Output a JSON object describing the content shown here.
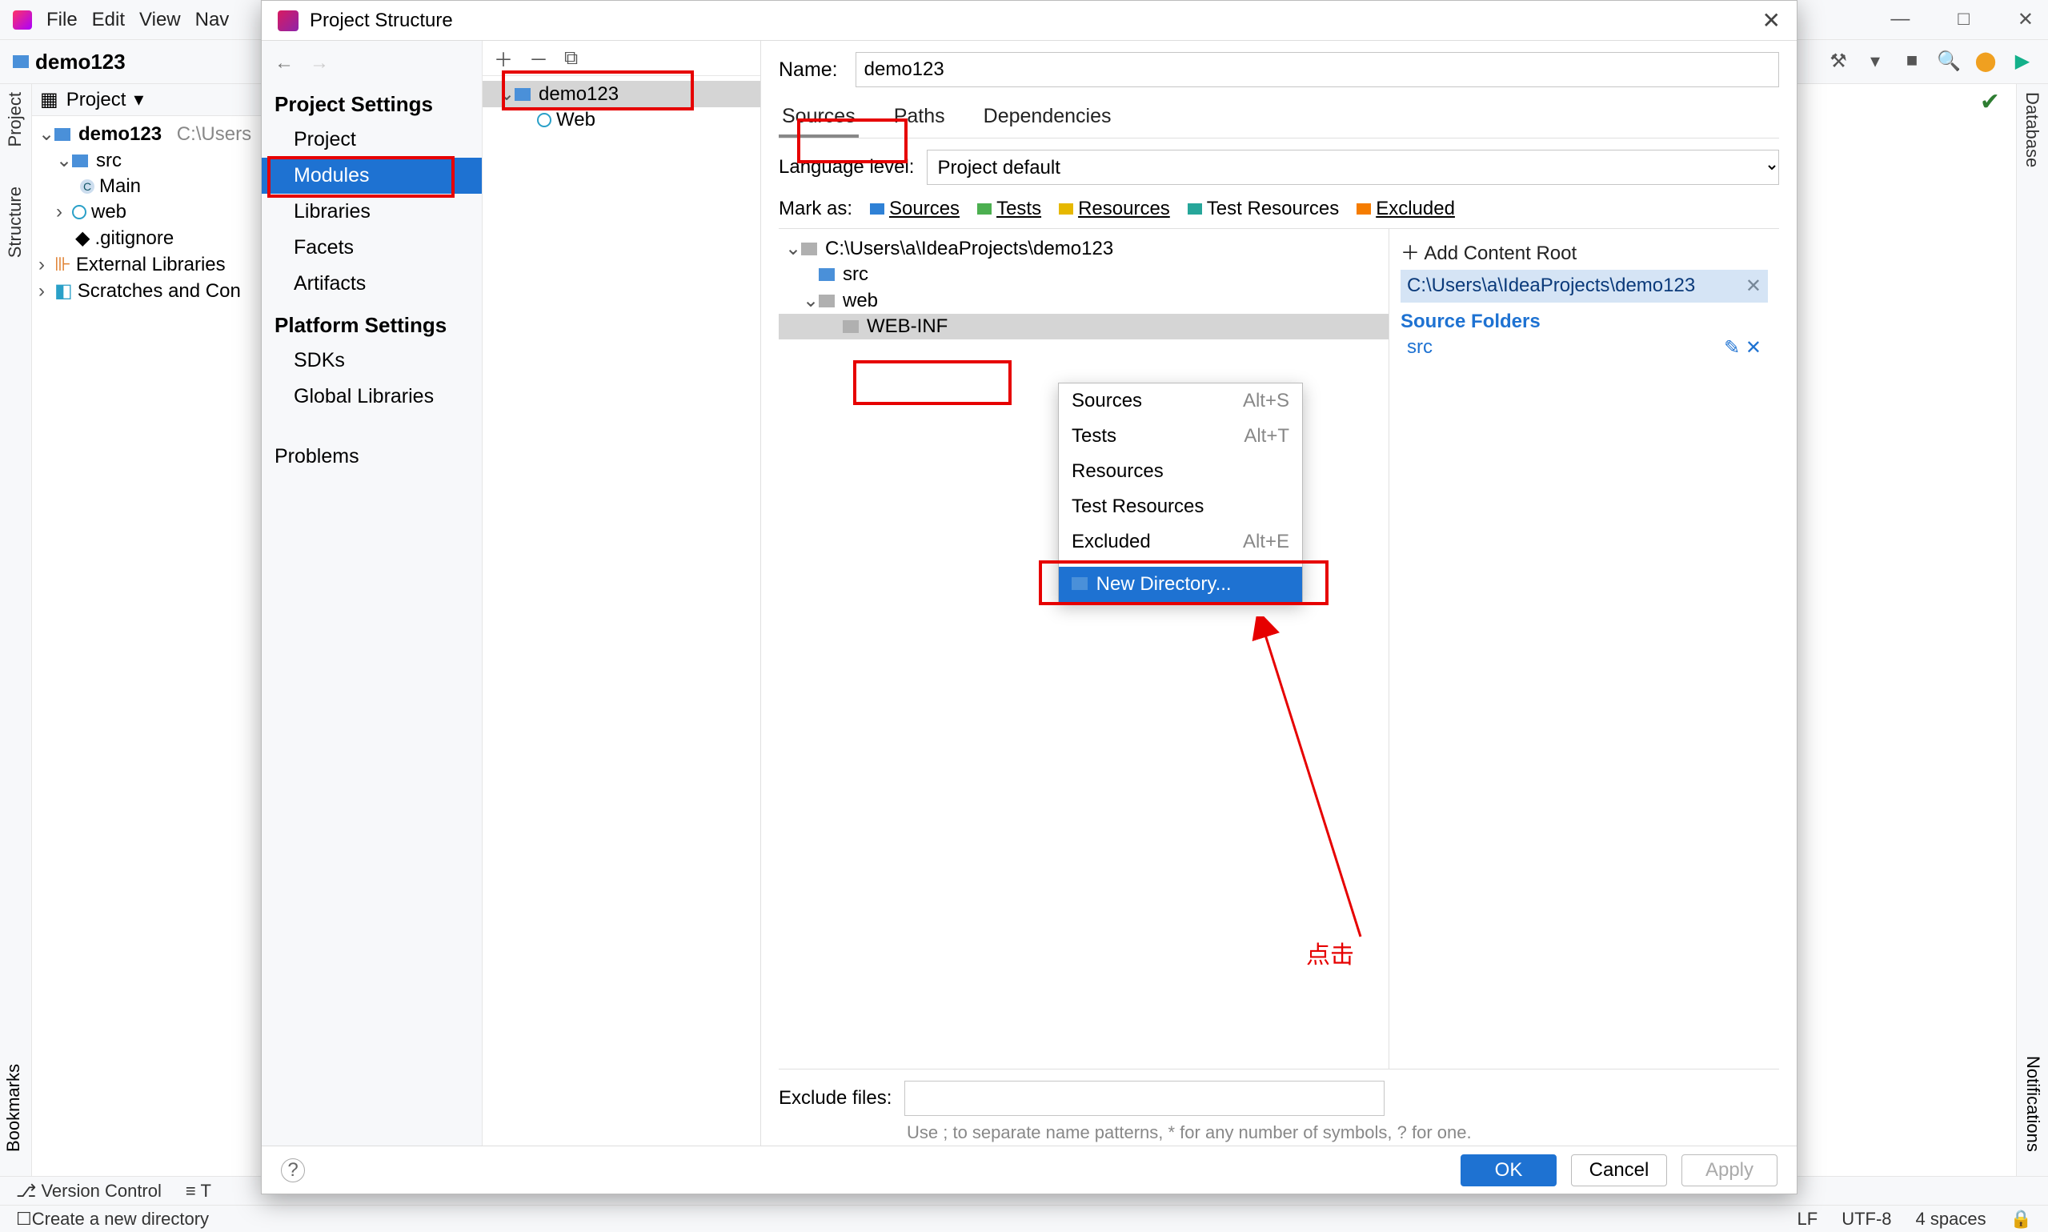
{
  "mainMenu": {
    "items": [
      "File",
      "Edit",
      "View",
      "Nav"
    ]
  },
  "breadcrumb": {
    "project": "demo123"
  },
  "projectPanel": {
    "title": "Project",
    "root": "demo123",
    "rootPath": "C:\\Users",
    "nodes": {
      "src": "src",
      "main": "Main",
      "web": "web",
      "gitignore": ".gitignore",
      "extLibs": "External Libraries",
      "scratches": "Scratches and Con"
    }
  },
  "leftGutter": {
    "project": "Project",
    "structure": "Structure"
  },
  "rightGutter": {
    "database": "Database",
    "notifications": "Notifications"
  },
  "bookmarks": "Bookmarks",
  "dialog": {
    "title": "Project Structure",
    "settingsNav": {
      "heading1": "Project Settings",
      "items1": [
        "Project",
        "Modules",
        "Libraries",
        "Facets",
        "Artifacts"
      ],
      "heading2": "Platform Settings",
      "items2": [
        "SDKs",
        "Global Libraries"
      ],
      "problems": "Problems"
    },
    "moduleTree": {
      "root": "demo123",
      "web": "Web"
    },
    "detail": {
      "nameLabel": "Name:",
      "nameValue": "demo123",
      "tabs": [
        "Sources",
        "Paths",
        "Dependencies"
      ],
      "languageLevelLabel": "Language level:",
      "languageLevelValue": "Project default",
      "markAs": {
        "label": "Mark as:",
        "sources": "Sources",
        "tests": "Tests",
        "resources": "Resources",
        "testResources": "Test Resources",
        "excluded": "Excluded"
      },
      "contentTree": {
        "root": "C:\\Users\\a\\IdeaProjects\\demo123",
        "src": "src",
        "web": "web",
        "webinf": "WEB-INF"
      },
      "sidePanel": {
        "addRoot": "Add Content Root",
        "rootPath": "C:\\Users\\a\\IdeaProjects\\demo123",
        "sourceFoldersHead": "Source Folders",
        "src": "src"
      },
      "exclude": {
        "label": "Exclude files:",
        "hint": "Use ; to separate name patterns, * for any number of symbols, ? for one."
      }
    },
    "contextMenu": {
      "sources": "Sources",
      "sourcesKey": "Alt+S",
      "tests": "Tests",
      "testsKey": "Alt+T",
      "resources": "Resources",
      "testResources": "Test Resources",
      "excluded": "Excluded",
      "excludedKey": "Alt+E",
      "newDirectory": "New Directory..."
    },
    "footer": {
      "ok": "OK",
      "cancel": "Cancel",
      "apply": "Apply"
    }
  },
  "annotation": {
    "click": "点击"
  },
  "bottomBar": {
    "versionControl": "Version Control",
    "todo": "T"
  },
  "statusBar": {
    "hint": "Create a new directory",
    "lf": "LF",
    "encoding": "UTF-8",
    "indent": "4 spaces"
  }
}
